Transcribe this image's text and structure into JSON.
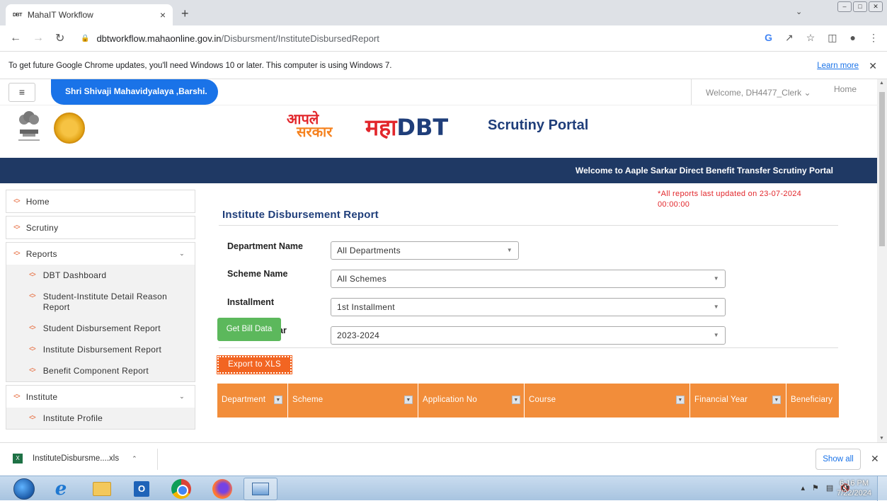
{
  "browser": {
    "tab_icon_text": "DBT",
    "tab_title": "MahaIT Workflow",
    "url_host": "dbtworkflow.mahaonline.gov.in",
    "url_path": "/Disbursment/InstituteDisbursedReport"
  },
  "infobar": {
    "message": "To get future Google Chrome updates, you'll need Windows 10 or later. This computer is using Windows 7.",
    "learn_more": "Learn more"
  },
  "site": {
    "college_name": "Shri Shivaji Mahavidyalaya ,Barshi.",
    "welcome_user": "Welcome, DH4477_Clerk",
    "home_link": "Home",
    "logo_line1": "आपले",
    "logo_line2": "सरकार",
    "logo_maha": "महा",
    "logo_dbt": "DBT",
    "portal_title": "Scrutiny Portal",
    "banner": "Welcome to Aaple Sarkar Direct Benefit Transfer Scrutiny Portal"
  },
  "sidebar": {
    "home": "Home",
    "scrutiny": "Scrutiny",
    "reports": "Reports",
    "report_items": [
      "DBT Dashboard",
      "Student-Institute Detail Reason Report",
      "Student Disbursement Report",
      "Institute Disbursement Report",
      "Benefit Component Report"
    ],
    "institute": "Institute",
    "institute_items": [
      "Institute Profile"
    ]
  },
  "report": {
    "updated_note": "*All reports last updated on 23-07-2024 00:00:00",
    "title": "Institute Disbursement Report",
    "fields": {
      "department_label": "Department Name",
      "department_value": "All Departments",
      "scheme_label": "Scheme Name",
      "scheme_value": "All Schemes",
      "installment_label": "Installment",
      "installment_value": "1st Installment",
      "year_label": "Financial Year",
      "year_value": "2023-2024"
    },
    "get_bill_button": "Get Bill Data",
    "export_button": "Export to XLS",
    "columns": [
      "Department",
      "Scheme",
      "Application No",
      "Course",
      "Financial Year",
      "Beneficiary"
    ]
  },
  "downloads": {
    "file_name": "InstituteDisbursme....xls",
    "show_all": "Show all"
  },
  "taskbar": {
    "time": "6:16 PM",
    "date": "7/22/2024"
  },
  "colors": {
    "banner_bg": "#1f3964",
    "college_pill": "#1a73e8",
    "table_header": "#f28d3a",
    "export_button": "#f26522",
    "bill_button": "#5cb85c",
    "title_blue": "#1f3e7a"
  }
}
